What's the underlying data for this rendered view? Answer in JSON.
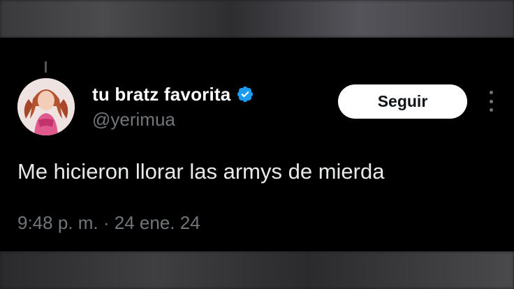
{
  "tweet": {
    "author": {
      "display_name": "tu bratz favorita",
      "handle": "@yerimua",
      "verified": true,
      "verified_icon": "verified-badge-icon"
    },
    "follow_label": "Seguir",
    "more_icon": "more-options-icon",
    "text": "Me hicieron llorar las armys de mierda",
    "time": "9:48 p. m.",
    "separator": "·",
    "date": "24 ene. 24"
  },
  "colors": {
    "background": "#000000",
    "primary_text": "#e7e9ea",
    "secondary_text": "#71767b",
    "verified": "#1d9bf0",
    "follow_button_bg": "#ffffff",
    "follow_button_text": "#0f1419"
  }
}
